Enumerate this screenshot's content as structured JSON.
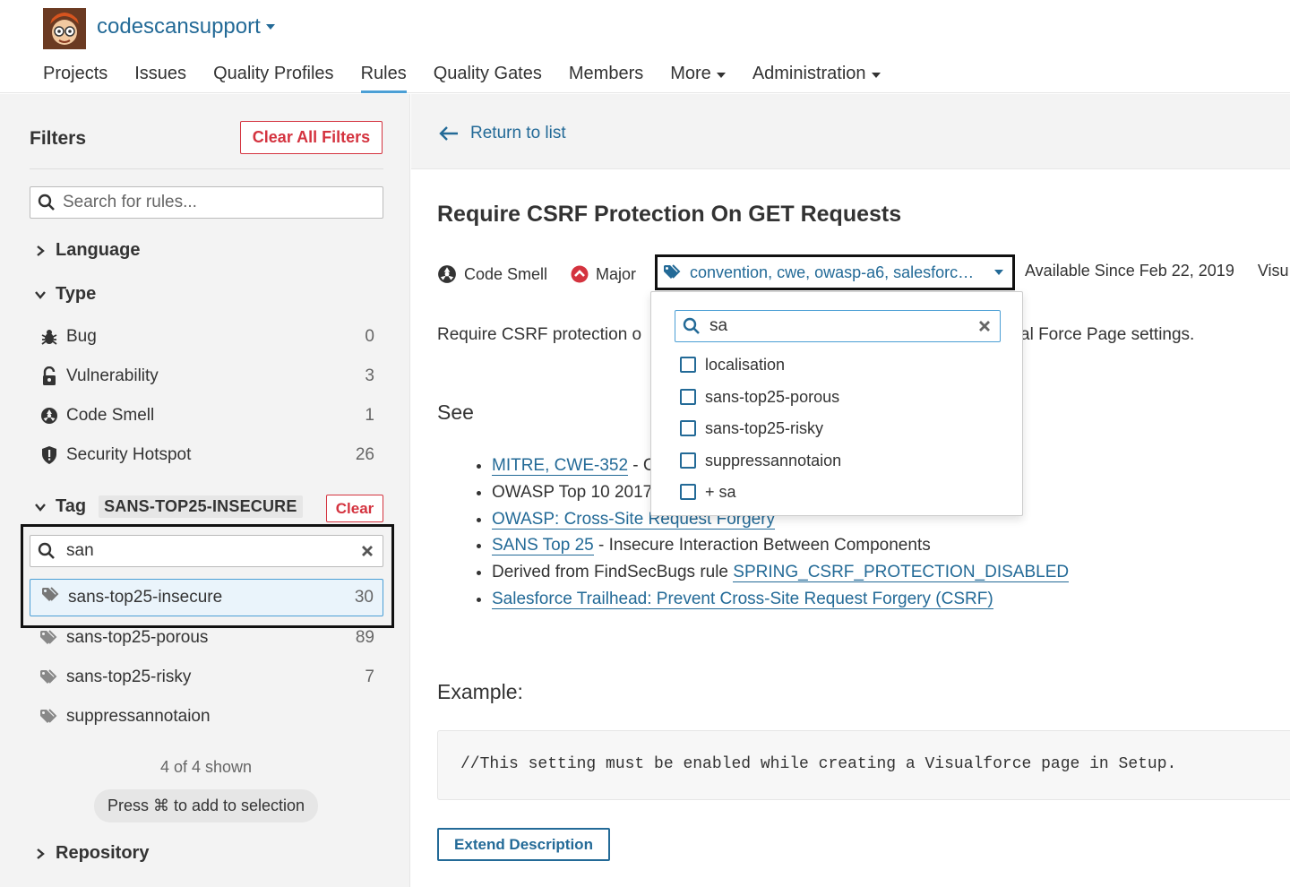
{
  "header": {
    "org_name": "codescansupport",
    "nav": [
      "Projects",
      "Issues",
      "Quality Profiles",
      "Rules",
      "Quality Gates",
      "Members",
      "More",
      "Administration"
    ],
    "active_nav": "Rules"
  },
  "sidebar": {
    "title": "Filters",
    "clear_all_label": "Clear All Filters",
    "search_placeholder": "Search for rules...",
    "language_label": "Language",
    "type_label": "Type",
    "types": [
      {
        "label": "Bug",
        "count": "0",
        "icon": "bug-icon"
      },
      {
        "label": "Vulnerability",
        "count": "3",
        "icon": "lock-icon"
      },
      {
        "label": "Code Smell",
        "count": "1",
        "icon": "code-smell-icon"
      },
      {
        "label": "Security Hotspot",
        "count": "26",
        "icon": "shield-icon"
      }
    ],
    "tag_label": "Tag",
    "tag_selected": "SANS-TOP25-INSECURE",
    "tag_clear_label": "Clear",
    "tag_search_value": "san",
    "tags": [
      {
        "label": "sans-top25-insecure",
        "count": "30"
      },
      {
        "label": "sans-top25-porous",
        "count": "89"
      },
      {
        "label": "sans-top25-risky",
        "count": "7"
      },
      {
        "label": "suppressannotaion",
        "count": ""
      }
    ],
    "shown_text": "4 of 4 shown",
    "hint_text": "Press ⌘ to add to selection",
    "repository_label": "Repository"
  },
  "main": {
    "back_label": "Return to list",
    "rule_title": "Require CSRF Protection On GET Requests",
    "type_label": "Code Smell",
    "severity_label": "Major",
    "tags_text": "convention, cwe, owasp-a6, salesforc…",
    "available_since": "Available Since Feb 22, 2019",
    "visu_cut": "Visu",
    "description_start": "Require CSRF protection o",
    "description_end": "al Force Page settings.",
    "see_label": "See",
    "refs": [
      {
        "link": "MITRE, CWE-352",
        "text": " - C"
      },
      {
        "link": "",
        "text": "OWASP Top 10 2017"
      },
      {
        "link": "OWASP: Cross-Site Request Forgery",
        "text": ""
      },
      {
        "link": "SANS Top 25",
        "text": " - Insecure Interaction Between Components"
      },
      {
        "link": "SPRING_CSRF_PROTECTION_DISABLED",
        "prefix": "Derived from FindSecBugs rule ",
        "text": ""
      },
      {
        "link": "Salesforce Trailhead: Prevent Cross-Site Request Forgery (CSRF)",
        "text": ""
      }
    ],
    "example_label": "Example:",
    "code": "//This setting must be enabled while creating a Visualforce page in Setup.",
    "extend_label": "Extend Description"
  },
  "tag_popup": {
    "search_value": "sa",
    "options": [
      "localisation",
      "sans-top25-porous",
      "sans-top25-risky",
      "suppressannotaion",
      "+ sa"
    ]
  },
  "colors": {
    "link": "#236a97",
    "danger": "#d4333f",
    "accent": "#4b9fd5"
  }
}
